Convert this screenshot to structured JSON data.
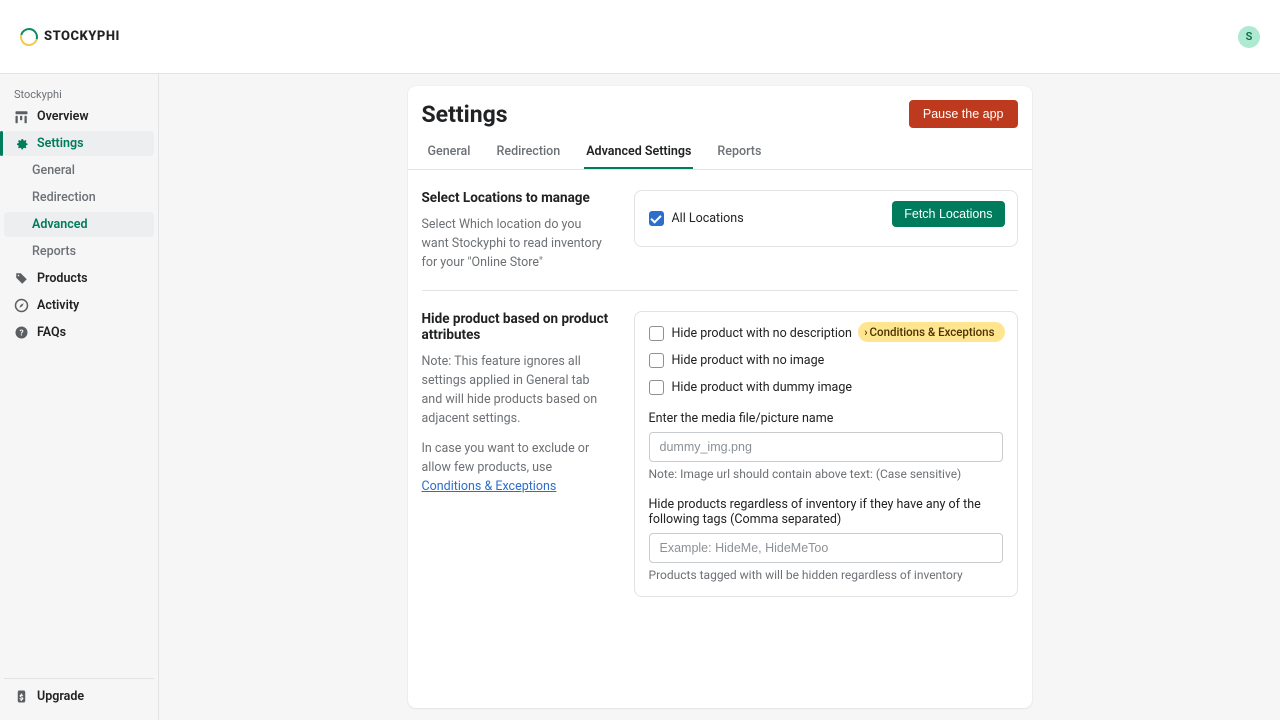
{
  "brand": {
    "name": "STOCKYPHI"
  },
  "avatar": {
    "initial": "S"
  },
  "sidebar": {
    "app_label": "Stockyphi",
    "items": [
      {
        "label": "Overview"
      },
      {
        "label": "Settings"
      },
      {
        "label": "Products"
      },
      {
        "label": "Activity"
      },
      {
        "label": "FAQs"
      }
    ],
    "sub": [
      {
        "label": "General"
      },
      {
        "label": "Redirection"
      },
      {
        "label": "Advanced"
      },
      {
        "label": "Reports"
      }
    ],
    "footer": {
      "label": "Upgrade"
    }
  },
  "page": {
    "title": "Settings",
    "pause_button": "Pause the app"
  },
  "tabs": [
    {
      "label": "General"
    },
    {
      "label": "Redirection"
    },
    {
      "label": "Advanced Settings"
    },
    {
      "label": "Reports"
    }
  ],
  "locations": {
    "title": "Select Locations to manage",
    "desc": "Select Which location do you want Stockyphi to read inventory for your \"Online Store\"",
    "fetch_button": "Fetch Locations",
    "all_label": "All Locations"
  },
  "attributes": {
    "title": "Hide product based on product attributes",
    "note": "Note: This feature ignores all settings applied in General tab and will hide products based on adjacent settings.",
    "desc2_pre": "In case you want to exclude or allow few products, use ",
    "desc2_link": "Conditions & Exceptions",
    "badge": "Conditions & Exceptions",
    "chk_no_desc": "Hide product with no description",
    "chk_no_img": "Hide product with no image",
    "chk_dummy": "Hide product with dummy image",
    "media_label": "Enter the media file/picture name",
    "media_placeholder": "dummy_img.png",
    "media_help": "Note: Image url should contain above text: (Case sensitive)",
    "tags_label": "Hide products regardless of inventory if they have any of the following tags (Comma separated)",
    "tags_placeholder": "Example: HideMe, HideMeToo",
    "tags_help": "Products tagged with will be hidden regardless of inventory"
  }
}
